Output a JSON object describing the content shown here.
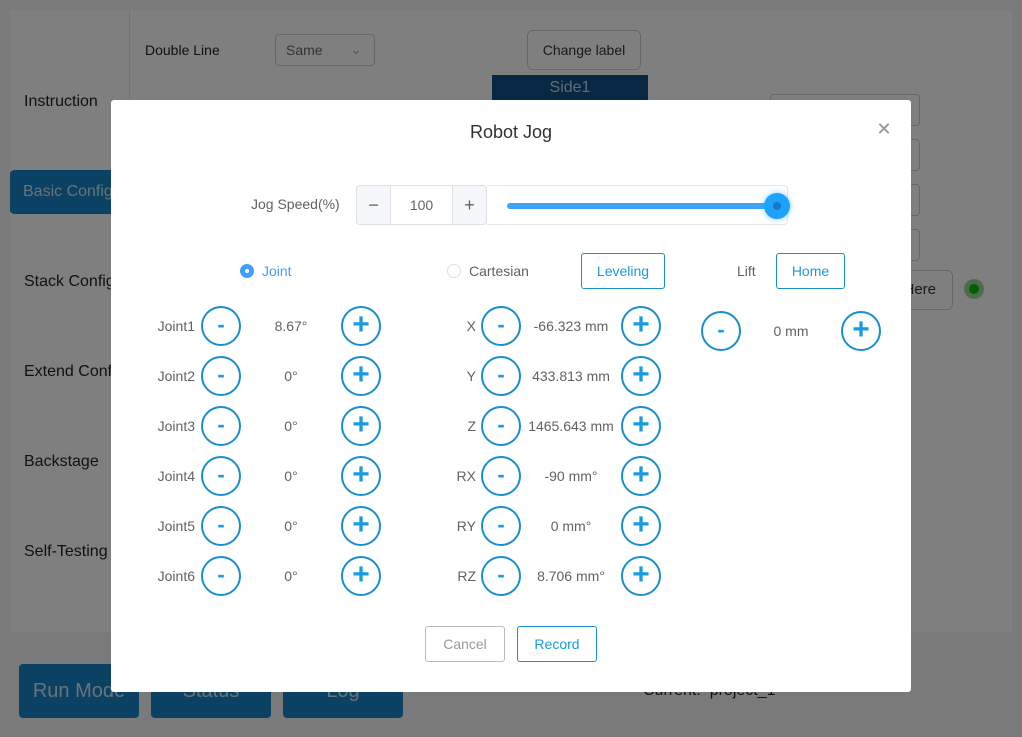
{
  "background": {
    "sidebar": [
      {
        "label": "Instruction",
        "active": false
      },
      {
        "label": "Basic Config",
        "active": true
      },
      {
        "label": "Stack Config",
        "active": false
      },
      {
        "label": "Extend Config",
        "active": false
      },
      {
        "label": "Backstage",
        "active": false
      },
      {
        "label": "Self-Testing",
        "active": false
      }
    ],
    "double_line_label": "Double Line",
    "double_line_value": "Same",
    "change_label_button": "Change label",
    "side_label": "Side1",
    "here_button": "Here",
    "status_color": "#00c000",
    "bottom_buttons": [
      "Run Mode",
      "Status",
      "Log"
    ],
    "current_label": "Current:",
    "current_value": "project_1"
  },
  "modal": {
    "title": "Robot Jog",
    "jog_speed_label": "Jog Speed(%)",
    "jog_speed_value": "100",
    "jog_speed_percent": 100,
    "modes": [
      {
        "label": "Joint",
        "selected": true
      },
      {
        "label": "Cartesian",
        "selected": false
      }
    ],
    "leveling_button": "Leveling",
    "lift_label": "Lift",
    "home_button": "Home",
    "lift_value": "0 mm",
    "joints": [
      {
        "label": "Joint1",
        "value": "8.67°"
      },
      {
        "label": "Joint2",
        "value": "0°"
      },
      {
        "label": "Joint3",
        "value": "0°"
      },
      {
        "label": "Joint4",
        "value": "0°"
      },
      {
        "label": "Joint5",
        "value": "0°"
      },
      {
        "label": "Joint6",
        "value": "0°"
      }
    ],
    "cartesian": [
      {
        "label": "X",
        "value": "-66.323 mm"
      },
      {
        "label": "Y",
        "value": "433.813 mm"
      },
      {
        "label": "Z",
        "value": "1465.643 mm"
      },
      {
        "label": "RX",
        "value": "-90 mm°"
      },
      {
        "label": "RY",
        "value": "0 mm°"
      },
      {
        "label": "RZ",
        "value": "8.706 mm°"
      }
    ],
    "minus_symbol": "-",
    "plus_symbol": "+",
    "cancel_button": "Cancel",
    "record_button": "Record",
    "accent_color": "#1a9be0"
  }
}
